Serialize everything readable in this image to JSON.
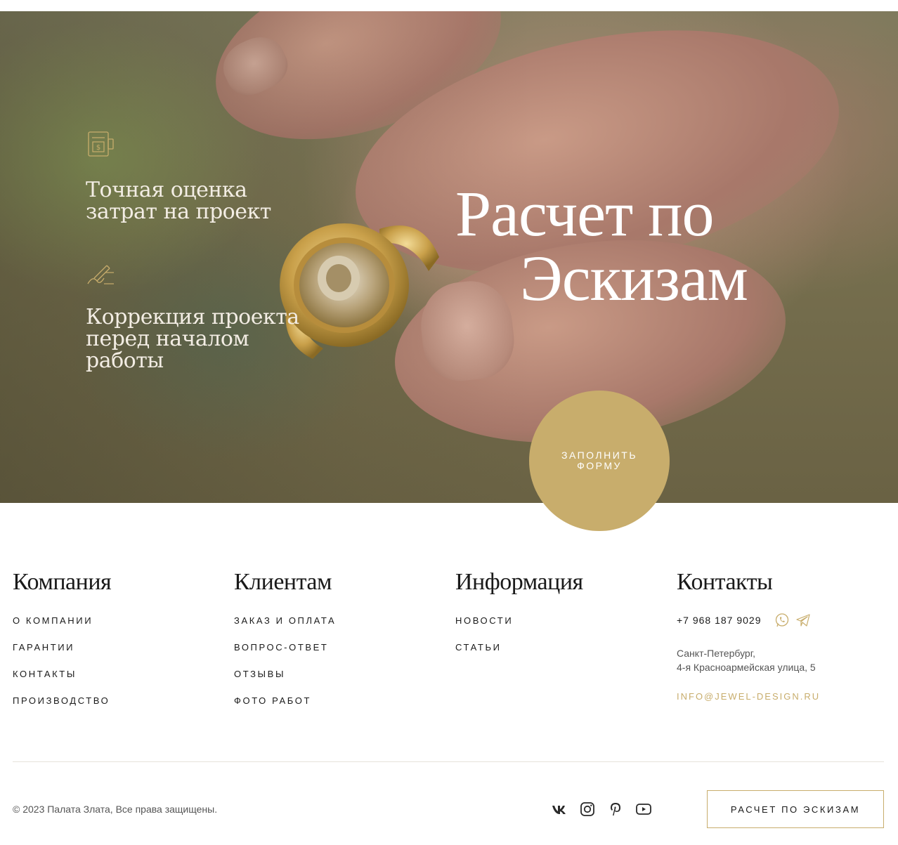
{
  "hero": {
    "title_line1": "Расчет по",
    "title_line2": "Эскизам",
    "features": [
      {
        "icon": "document-estimate-icon",
        "text": "Точная оценка\nзатрат на проект"
      },
      {
        "icon": "pen-signature-icon",
        "text": "Коррекция проекта\nперед началом\nработы"
      }
    ],
    "cta_label": "ЗАПОЛНИТЬ\nФОРМУ",
    "accent_color": "#c8ad6c"
  },
  "footer": {
    "columns": [
      {
        "title": "Компания",
        "links": [
          "О компании",
          "Гарантии",
          "Контакты",
          "Производство"
        ]
      },
      {
        "title": "Клиентам",
        "links": [
          "Заказ и оплата",
          "Вопрос-ответ",
          "Отзывы",
          "Фото работ"
        ]
      },
      {
        "title": "Информация",
        "links": [
          "Новости",
          "Статьи"
        ]
      }
    ],
    "contacts": {
      "title": "Контакты",
      "phone": "+7 968 187 9029",
      "messengers": [
        "whatsapp-icon",
        "telegram-icon"
      ],
      "address_line1": "Санкт-Петербург,",
      "address_line2": "4-я Красноармейская улица, 5",
      "email": "INFO@JEWEL-DESIGN.RU"
    },
    "copyright": "© 2023 Палата Злата, Все права защищены.",
    "social": [
      "vk-icon",
      "instagram-icon",
      "pinterest-icon",
      "youtube-icon"
    ],
    "button_label": "РАСЧЕТ ПО ЭСКИЗАМ"
  }
}
